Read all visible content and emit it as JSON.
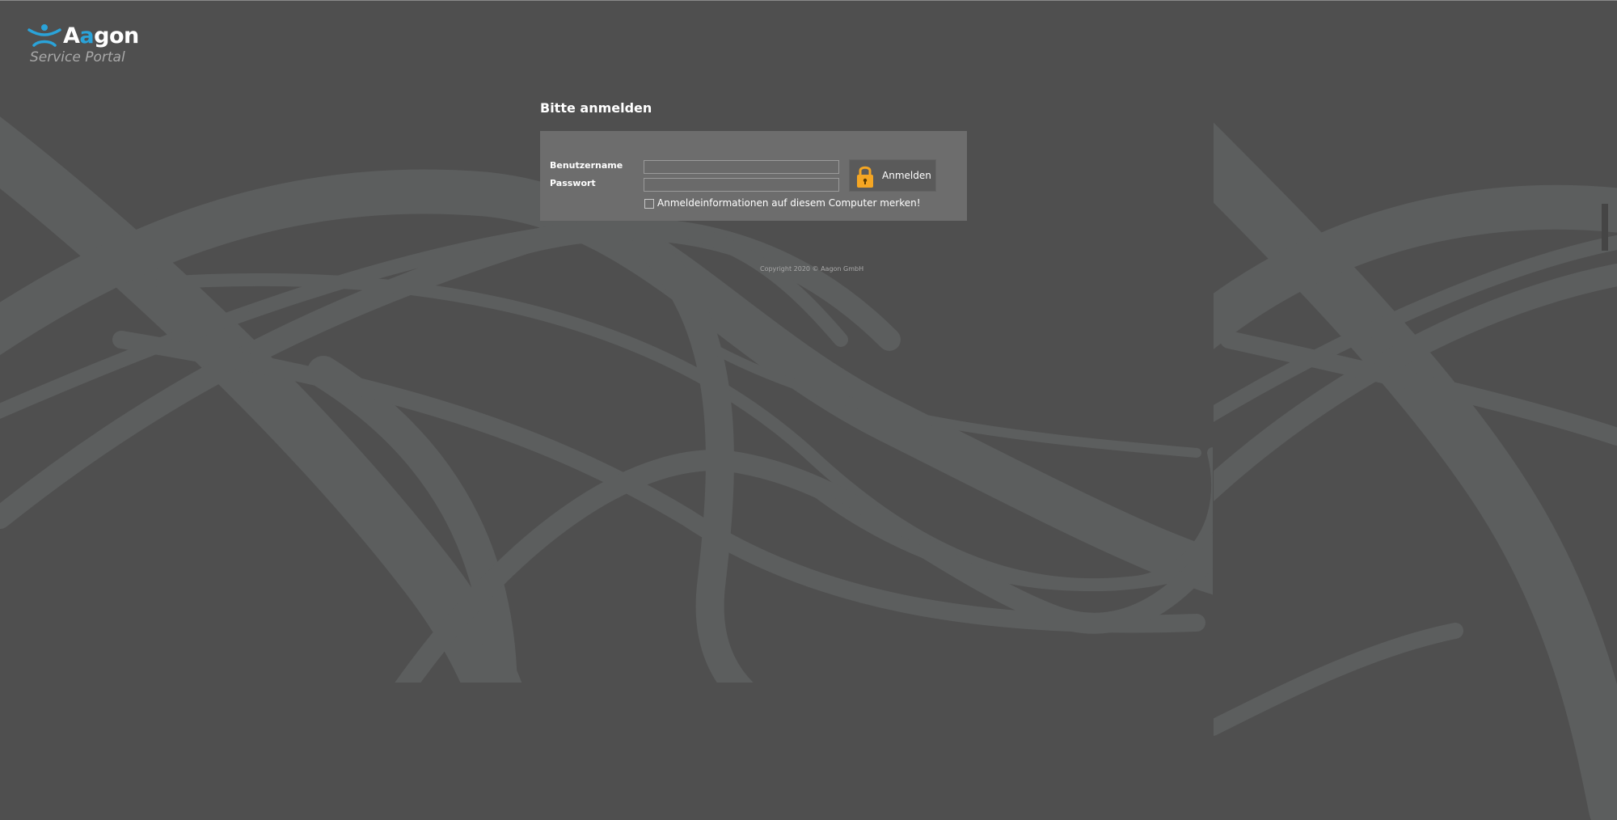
{
  "logo": {
    "brand_prefix": "A",
    "brand_accent": "a",
    "brand_suffix": "gon",
    "subtitle": "Service Portal",
    "icon": "aagon-figure-icon",
    "accent_color": "#2aa3d9"
  },
  "login": {
    "title": "Bitte anmelden",
    "username_label": "Benutzername",
    "password_label": "Passwort",
    "username_value": "",
    "password_value": "",
    "button_label": "Anmelden",
    "button_icon": "lock-icon",
    "lock_color": "#f5a623",
    "remember_label": "Anmeldeinformationen auf diesem Computer merken!",
    "remember_checked": false
  },
  "footer": {
    "copyright": "Copyright 2020 © Aagon GmbH"
  },
  "colors": {
    "background": "#4f4f4f",
    "panel": "#6d6d6d",
    "swirl": "#5e6060"
  }
}
